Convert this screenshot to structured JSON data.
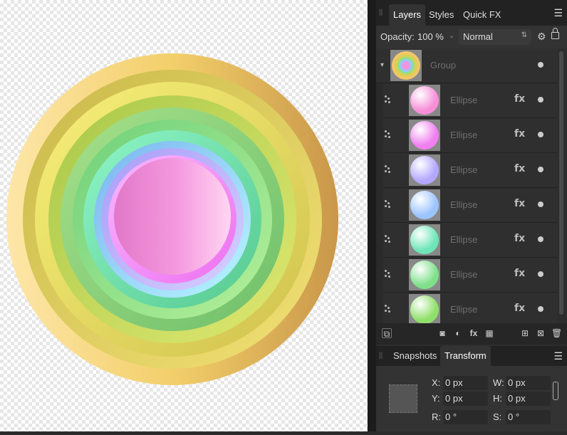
{
  "layers_panel": {
    "tabs": [
      "Layers",
      "Styles",
      "Quick FX"
    ],
    "opacity_label": "Opacity:",
    "opacity_value": "100 %",
    "blend_mode": "Normal",
    "group_name": "Group",
    "layers": [
      {
        "name": "Ellipse",
        "fill": "#f78fd8"
      },
      {
        "name": "Ellipse",
        "fill": "#f07ff0"
      },
      {
        "name": "Ellipse",
        "fill": "#b3a8ff"
      },
      {
        "name": "Ellipse",
        "fill": "#9cc4ff"
      },
      {
        "name": "Ellipse",
        "fill": "#6fe6b8"
      },
      {
        "name": "Ellipse",
        "fill": "#7fe08a"
      },
      {
        "name": "Ellipse",
        "fill": "#8fe06a"
      }
    ],
    "fx_label": "fx"
  },
  "secondary_panel": {
    "tabs": [
      "Snapshots",
      "Transform"
    ],
    "x_label": "X:",
    "x_value": "0 px",
    "y_label": "Y:",
    "y_value": "0 px",
    "w_label": "W:",
    "w_value": "0 px",
    "h_label": "H:",
    "h_value": "0 px",
    "r_label": "R:",
    "r_value": "0 °",
    "s_label": "S:",
    "s_value": "0 °"
  },
  "colors": {
    "ring_outer": "#f2c66a",
    "ring_mid": "#c9c74a",
    "ring_inner": "#f096dd"
  }
}
